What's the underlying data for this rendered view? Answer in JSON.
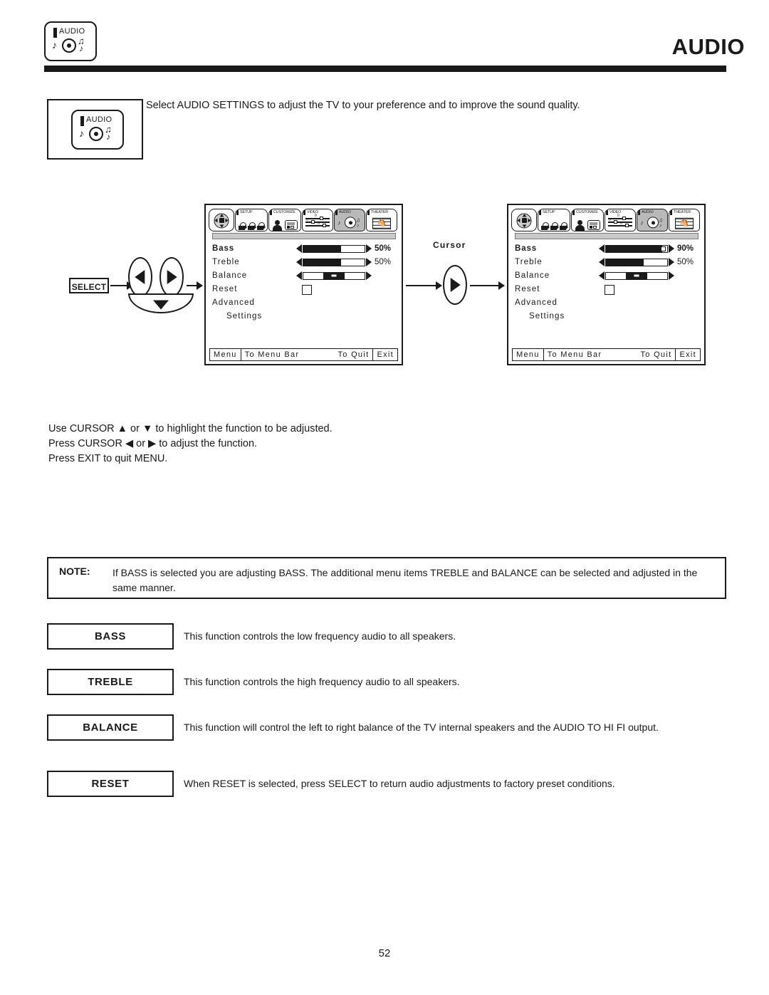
{
  "header": {
    "title": "AUDIO",
    "badge_icon": "audio-icon",
    "badge_label": "AUDIO"
  },
  "intro": {
    "icon_label": "AUDIO",
    "text": "Select AUDIO SETTINGS to adjust the TV to your preference and to improve the sound quality."
  },
  "flow": {
    "select_button": "SELECT",
    "cursor_label": "Cursor"
  },
  "osd_left": {
    "tabs": [
      {
        "caption": "",
        "icon": "dpad-icon",
        "selected": false
      },
      {
        "caption": "SETUP",
        "icon": "camera-icon",
        "selected": false
      },
      {
        "caption": "CUSTOMIZE",
        "icon": "person-cc-icon",
        "selected": false
      },
      {
        "caption": "VIDEO",
        "icon": "sliders-icon",
        "selected": false
      },
      {
        "caption": "AUDIO",
        "icon": "audio-note-icon",
        "selected": true
      },
      {
        "caption": "THEATER",
        "icon": "filmstrip-icon",
        "selected": false
      }
    ],
    "rows": [
      {
        "label": "Bass",
        "bold": true,
        "control": "bar",
        "fill_pct": 62,
        "knob": false,
        "value": "50%",
        "value_bold": true
      },
      {
        "label": "Treble",
        "bold": false,
        "control": "bar",
        "fill_pct": 62,
        "knob": false,
        "value": "50%",
        "value_bold": false
      },
      {
        "label": "Balance",
        "bold": false,
        "control": "center-bar",
        "value": "",
        "value_bold": false
      },
      {
        "label": "Reset",
        "bold": false,
        "control": "checkbox",
        "value": "",
        "value_bold": false
      },
      {
        "label": "Advanced",
        "bold": false,
        "control": "none",
        "value": "",
        "value_bold": false
      },
      {
        "label": "Settings",
        "bold": false,
        "indent": true,
        "control": "none",
        "value": "",
        "value_bold": false
      }
    ],
    "footer": {
      "menu": "Menu",
      "to_menu_bar": "To Menu Bar",
      "to_quit": "To Quit",
      "exit": "Exit"
    }
  },
  "osd_right": {
    "tabs": [
      {
        "caption": "",
        "icon": "dpad-icon",
        "selected": false
      },
      {
        "caption": "SETUP",
        "icon": "camera-icon",
        "selected": false
      },
      {
        "caption": "CUSTOMIZE",
        "icon": "person-cc-icon",
        "selected": false
      },
      {
        "caption": "VIDEO",
        "icon": "sliders-icon",
        "selected": false
      },
      {
        "caption": "AUDIO",
        "icon": "audio-note-icon",
        "selected": true
      },
      {
        "caption": "THEATER",
        "icon": "filmstrip-icon",
        "selected": false
      }
    ],
    "rows": [
      {
        "label": "Bass",
        "bold": true,
        "control": "bar",
        "fill_pct": 92,
        "knob": true,
        "value": "90%",
        "value_bold": true
      },
      {
        "label": "Treble",
        "bold": false,
        "control": "bar",
        "fill_pct": 62,
        "knob": false,
        "value": "50%",
        "value_bold": false
      },
      {
        "label": "Balance",
        "bold": false,
        "control": "center-bar",
        "value": "",
        "value_bold": false
      },
      {
        "label": "Reset",
        "bold": false,
        "control": "checkbox",
        "value": "",
        "value_bold": false
      },
      {
        "label": "Advanced",
        "bold": false,
        "control": "none",
        "value": "",
        "value_bold": false
      },
      {
        "label": "Settings",
        "bold": false,
        "indent": true,
        "control": "none",
        "value": "",
        "value_bold": false
      }
    ],
    "footer": {
      "menu": "Menu",
      "to_menu_bar": "To Menu Bar",
      "to_quit": "To Quit",
      "exit": "Exit"
    }
  },
  "instructions": {
    "line1": "Use CURSOR ▲ or ▼ to highlight the function to be adjusted.",
    "line2": "Press CURSOR ◀ or ▶ to adjust the function.",
    "line3": "Press EXIT to quit MENU."
  },
  "note": {
    "label": "NOTE:",
    "text": "If BASS is selected you are adjusting BASS.  The additional menu items TREBLE and BALANCE can be selected and adjusted in the same manner."
  },
  "functions": [
    {
      "key": "BASS",
      "desc": "This function controls the low frequency audio to all speakers."
    },
    {
      "key": "TREBLE",
      "desc": "This function controls the high frequency audio to all speakers."
    },
    {
      "key": "BALANCE",
      "desc": "This function will control the left to right balance of the TV internal speakers and the AUDIO TO HI FI output."
    },
    {
      "key": "RESET",
      "desc": "When RESET is selected, press SELECT to return audio adjustments to factory preset conditions."
    }
  ],
  "page_number": "52",
  "colors": {
    "ink": "#1a1a1a",
    "selected_tab": "#b9b9b9",
    "gray_bar": "#c9c9c9"
  }
}
